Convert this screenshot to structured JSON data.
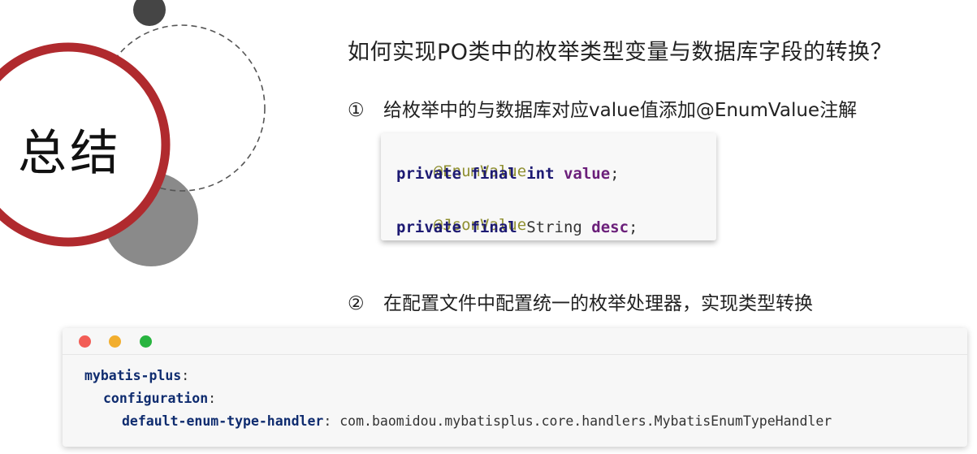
{
  "slide": {
    "hero_text": "总结",
    "question": "如何实现PO类中的枚举类型变量与数据库字段的转换？",
    "steps": [
      {
        "num": "①",
        "text": "给枚举中的与数据库对应value值添加@EnumValue注解"
      },
      {
        "num": "②",
        "text": "在配置文件中配置统一的枚举处理器，实现类型转换"
      }
    ]
  },
  "java_code": {
    "l1_annotation": "@EnumValue",
    "l2_private": "private",
    "l2_final": "final",
    "l2_type": "int",
    "l2_field": "value",
    "l2_end": ";",
    "l3_annotation": "@JsonValue",
    "l4_private": "private",
    "l4_final": "final",
    "l4_type": "String",
    "l4_field": "desc",
    "l4_end": ";"
  },
  "yaml_code": {
    "l1_key": "mybatis-plus",
    "l2_key": "configuration",
    "l3_key": "default-enum-type-handler",
    "colon": ":",
    "l3_value": " com.baomidou.mybatisplus.core.handlers.MybatisEnumTypeHandler"
  },
  "colors": {
    "ring_red": "#b02a2e",
    "dark_circle": "#454545",
    "gray_circle": "#8a8a8a",
    "window_red": "#f25d56",
    "window_yellow": "#f2ae2e",
    "window_green": "#28b43f"
  }
}
